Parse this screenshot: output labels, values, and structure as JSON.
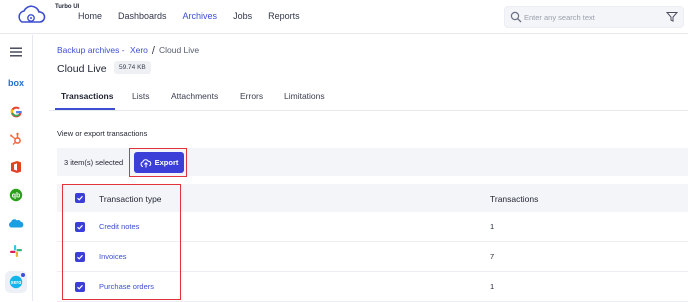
{
  "app": {
    "logo_text": "Turbo UI"
  },
  "nav": {
    "items": [
      {
        "label": "Home",
        "active": false
      },
      {
        "label": "Dashboards",
        "active": false
      },
      {
        "label": "Archives",
        "active": true
      },
      {
        "label": "Jobs",
        "active": false
      },
      {
        "label": "Reports",
        "active": false
      }
    ]
  },
  "search": {
    "placeholder": "Enter any search text",
    "value": ""
  },
  "sidebar": {
    "apps": [
      {
        "name": "box",
        "label": "box"
      },
      {
        "name": "google"
      },
      {
        "name": "hubspot"
      },
      {
        "name": "office"
      },
      {
        "name": "quickbooks"
      },
      {
        "name": "salesforce"
      },
      {
        "name": "slack"
      },
      {
        "name": "xero",
        "selected": true
      }
    ]
  },
  "breadcrumb": {
    "link1": "Backup archives -",
    "link2": "Xero",
    "separator": "/",
    "current": "Cloud Live"
  },
  "page": {
    "title": "Cloud Live",
    "size": "59.74 KB"
  },
  "tabs": [
    "Transactions",
    "Lists",
    "Attachments",
    "Errors",
    "Limitations"
  ],
  "active_tab": "Transactions",
  "section": {
    "label": "View or export transactions"
  },
  "actions": {
    "selected_count": "3 item(s) selected",
    "export_label": "Export"
  },
  "table": {
    "headers": {
      "type": "Transaction type",
      "count": "Transactions"
    },
    "rows": [
      {
        "type": "Credit notes",
        "count": "1",
        "checked": true
      },
      {
        "type": "Invoices",
        "count": "7",
        "checked": true
      },
      {
        "type": "Purchase orders",
        "count": "1",
        "checked": true
      }
    ]
  },
  "colors": {
    "accent": "#3b3fd8",
    "link": "#3d4ed1",
    "highlight": "#e0333c"
  }
}
